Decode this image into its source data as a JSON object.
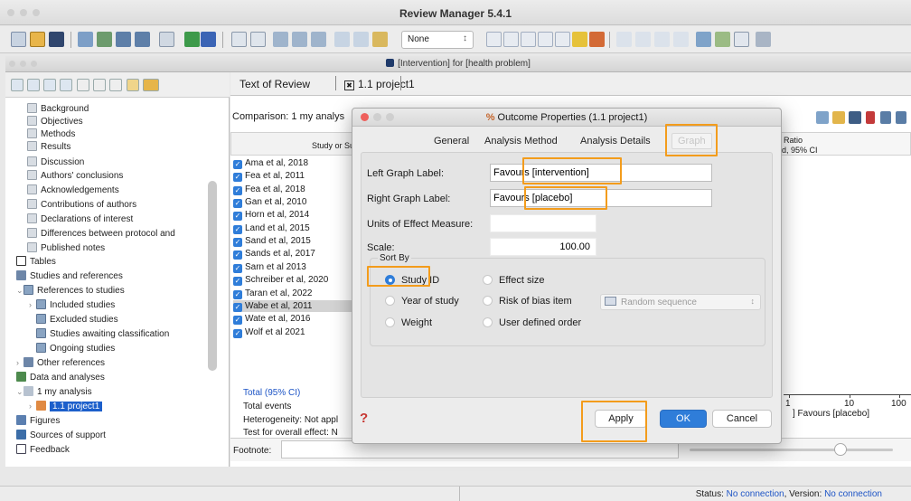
{
  "app": {
    "title": "Review Manager 5.4.1"
  },
  "toolbar": {
    "style_select": "None",
    "chevron": "↕"
  },
  "inner_window": {
    "title": "[Intervention] for [health problem]"
  },
  "sidebar": {
    "items": [
      {
        "label": "Background",
        "icon": "document-icon"
      },
      {
        "label": "Objectives",
        "icon": "document-icon"
      },
      {
        "label": "Methods",
        "icon": "document-icon"
      },
      {
        "label": "Results",
        "icon": "document-icon"
      },
      {
        "label": "Discussion",
        "icon": "document-icon"
      },
      {
        "label": "Authors' conclusions",
        "icon": "document-icon"
      },
      {
        "label": "Acknowledgements",
        "icon": "document-icon"
      },
      {
        "label": "Contributions of authors",
        "icon": "document-icon"
      },
      {
        "label": "Declarations of interest",
        "icon": "document-icon"
      },
      {
        "label": "Differences between protocol and",
        "icon": "document-icon"
      },
      {
        "label": "Published notes",
        "icon": "document-icon"
      },
      {
        "label": "Tables",
        "icon": "table-icon"
      },
      {
        "label": "Studies and references",
        "icon": "books-icon"
      },
      {
        "label": "References to studies",
        "icon": "references-icon"
      },
      {
        "label": "Included studies",
        "icon": "references-icon"
      },
      {
        "label": "Excluded studies",
        "icon": "references-icon"
      },
      {
        "label": "Studies awaiting classification",
        "icon": "references-icon"
      },
      {
        "label": "Ongoing studies",
        "icon": "references-icon"
      },
      {
        "label": "Other references",
        "icon": "books-icon"
      },
      {
        "label": "Data and analyses",
        "icon": "data-icon"
      },
      {
        "label": "1 my analysis",
        "icon": "analysis-icon"
      },
      {
        "label": "1.1 project1",
        "icon": "outcome-icon"
      },
      {
        "label": "Figures",
        "icon": "figures-icon"
      },
      {
        "label": "Sources of support",
        "icon": "support-icon"
      },
      {
        "label": "Feedback",
        "icon": "feedback-icon"
      }
    ]
  },
  "tabs": {
    "text": "Text of Review",
    "project": "1.1 project1",
    "close_glyph": "✖"
  },
  "plot": {
    "comparison": "Comparison: 1 my analys",
    "study_header": "Study or Su",
    "right_header_line1": "k Ratio",
    "right_header_line2": "ed, 95% CI",
    "studies": [
      "Ama et al, 2018",
      "Fea et al, 2011",
      "Fea et al, 2018",
      "Gan et al, 2010",
      "Horn et al, 2014",
      "Land et al, 2015",
      "Sand et al, 2015",
      "Sands et al, 2017",
      "Sarn et al 2013",
      "Schreiber et al, 2020",
      "Taran et al, 2022",
      "Wabe et al, 2011",
      "Wate et al, 2016",
      "Wolf et al 2021"
    ],
    "check_glyph": "✓",
    "total_label": "Total (95% CI)",
    "total_events": "Total events",
    "heterogeneity": "Heterogeneity: Not appl",
    "overall_effect": "Test for overall effect: N",
    "axis_ticks": [
      "1",
      "10",
      "100"
    ],
    "favours_right": "]  Favours [placebo]",
    "footnote_label": "Footnote:"
  },
  "dialog": {
    "title": "Outcome Properties (1.1 project1)",
    "title_icon": "%",
    "tabs": [
      "General",
      "Analysis Method",
      "Analysis Details",
      "Graph"
    ],
    "left_graph_label": "Left Graph Label:",
    "left_graph_value": "Favours [intervention]",
    "right_graph_label": "Right Graph Label:",
    "right_graph_value": "Favours [placebo]",
    "units_label": "Units of Effect Measure:",
    "units_value": "",
    "scale_label": "Scale:",
    "scale_value": "100.00",
    "sort_by_label": "Sort By",
    "sort_options": [
      {
        "label": "Study ID",
        "selected": true
      },
      {
        "label": "Effect size",
        "selected": false
      },
      {
        "label": "Year of study",
        "selected": false
      },
      {
        "label": "Risk of bias item",
        "selected": false
      },
      {
        "label": "Weight",
        "selected": false
      },
      {
        "label": "User defined order",
        "selected": false
      }
    ],
    "risk_select": "Random sequence",
    "risk_select_chevron": "↕",
    "help_glyph": "?",
    "apply": "Apply",
    "ok": "OK",
    "cancel": "Cancel"
  },
  "status": {
    "prefix": "Status:",
    "connection": "No connection",
    "version_prefix": ", Version:",
    "version": "No connection"
  },
  "colors": {
    "accent": "#2f7dd9",
    "highlight": "#f39c1c",
    "selection": "#1c5fcb"
  }
}
